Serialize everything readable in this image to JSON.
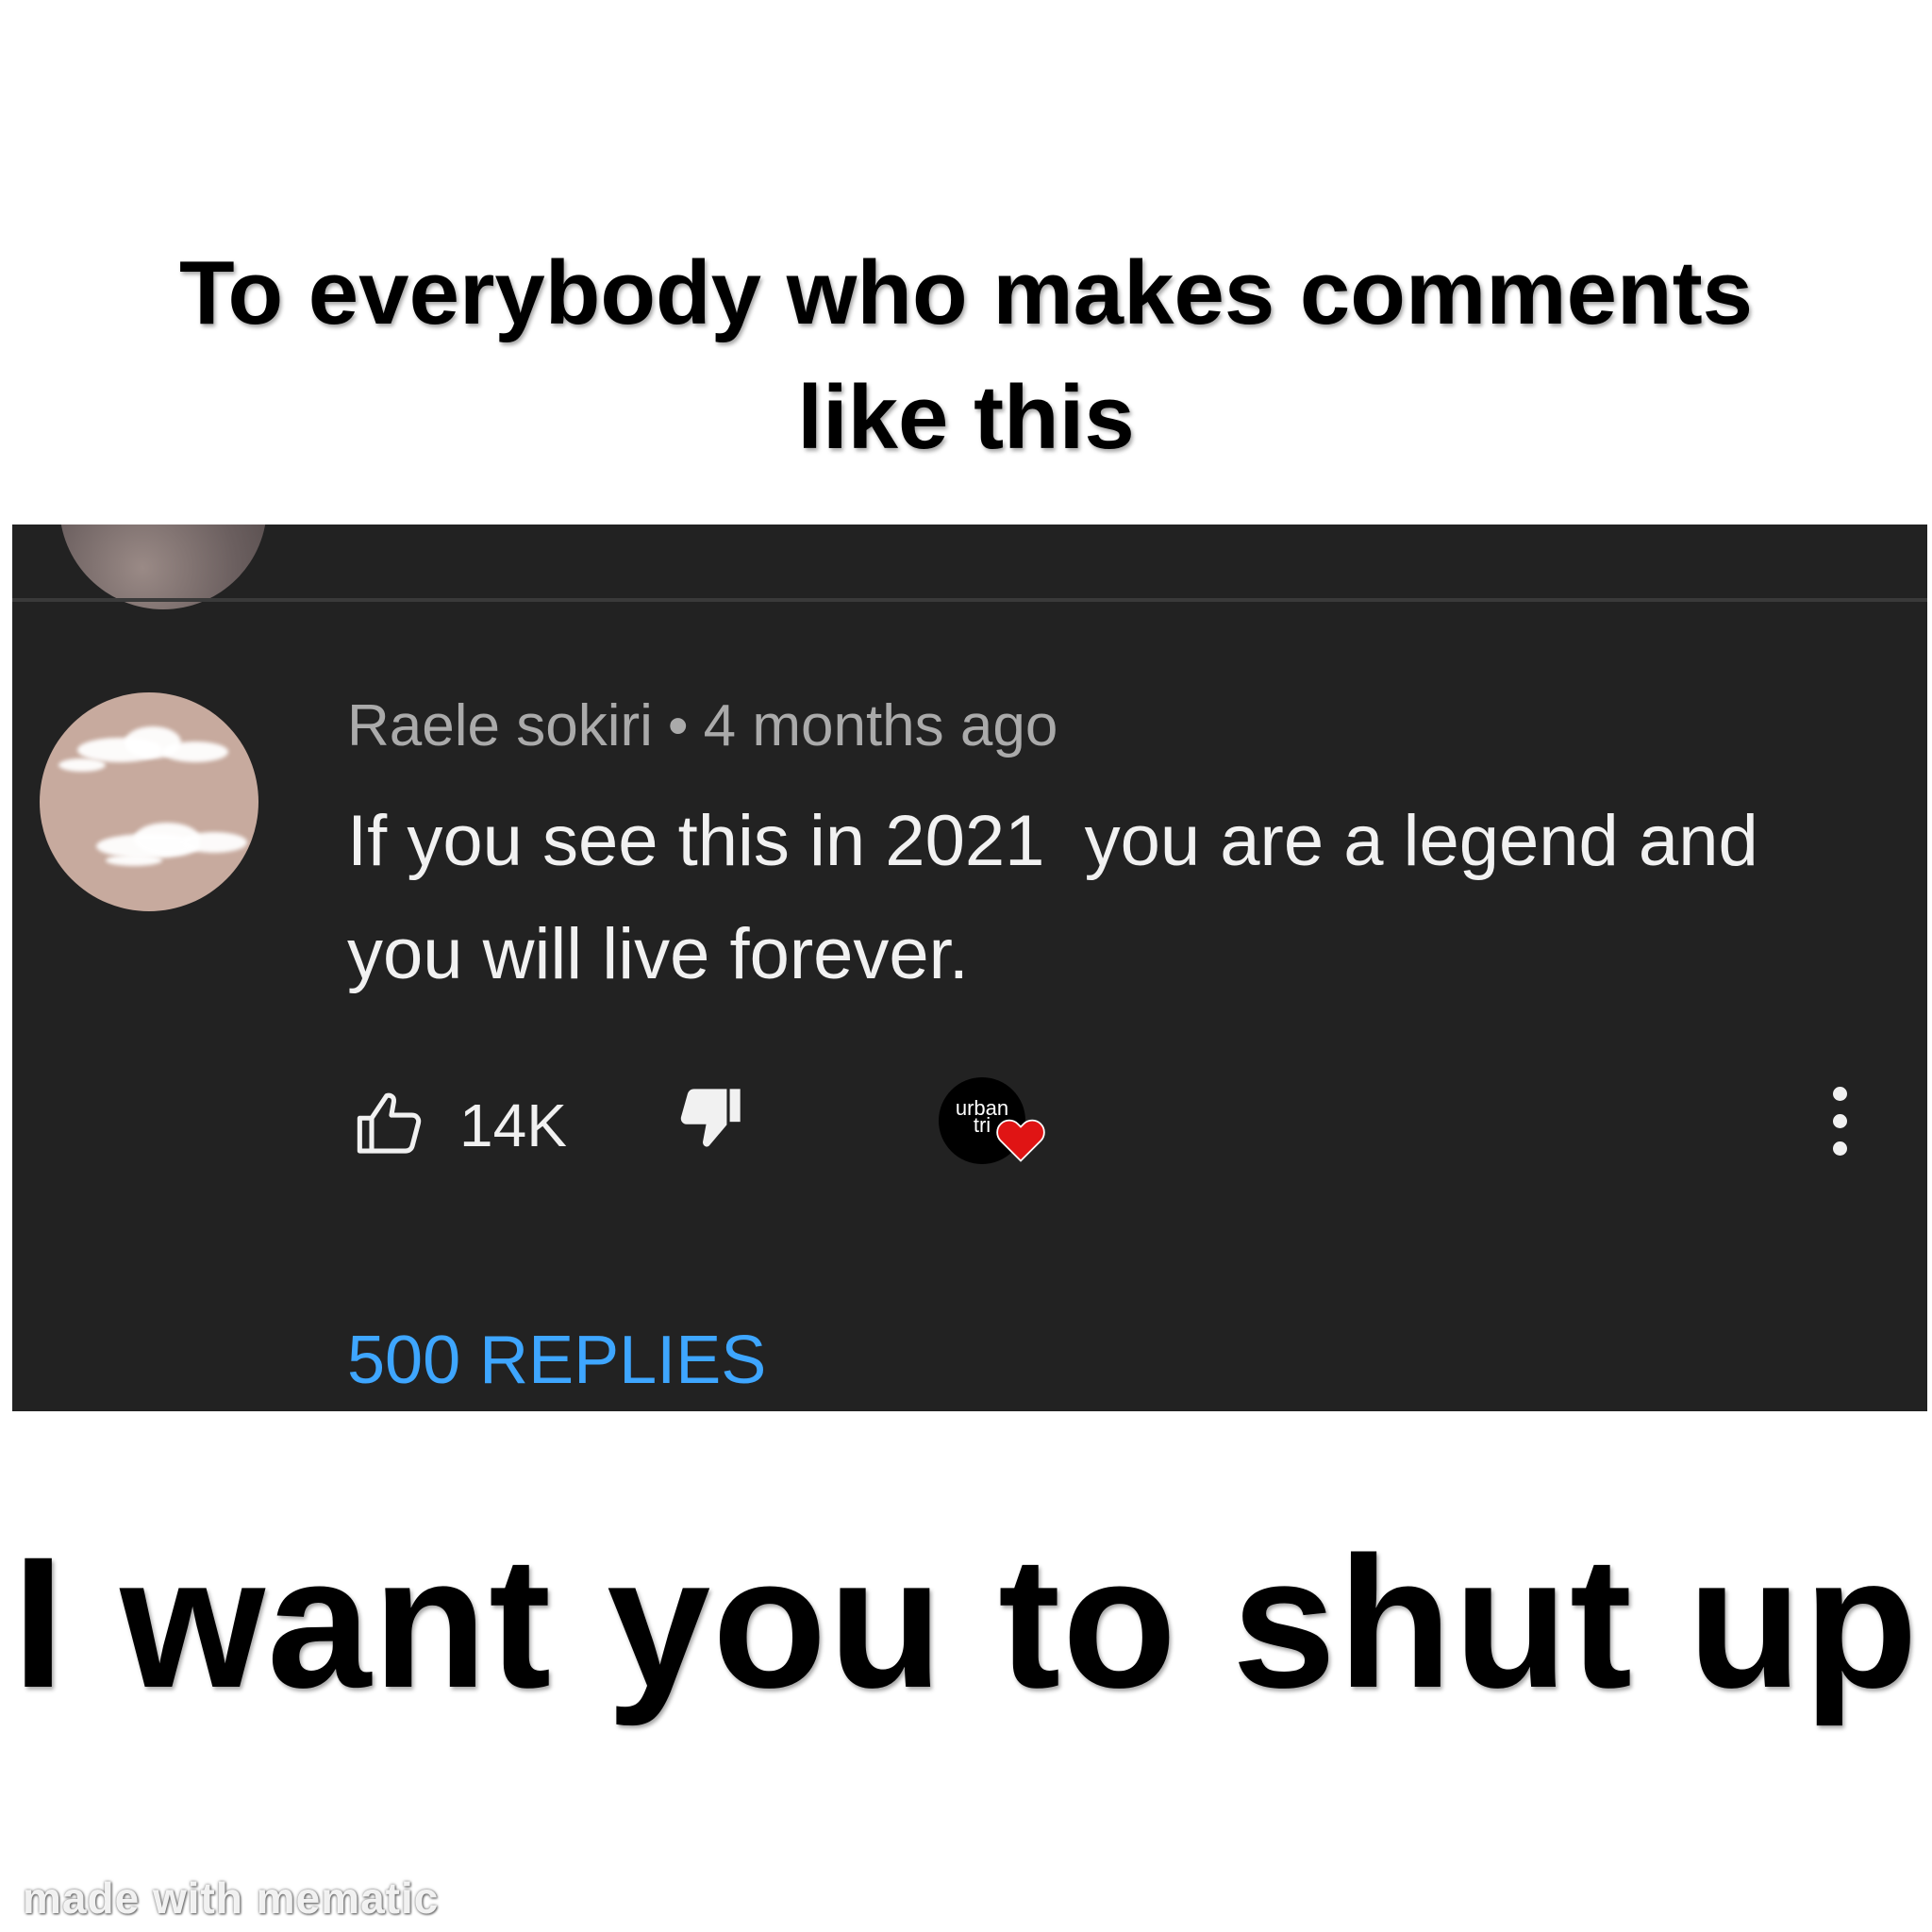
{
  "meme": {
    "top_caption": [
      "To everybody who makes comments",
      "like this"
    ],
    "bottom_caption": "I want you to shut up",
    "watermark": "made with mematic"
  },
  "comment": {
    "author": "Raele sokiri",
    "separator": "•",
    "timestamp": "4 months ago",
    "text": "If you see this in 2021  you are a legend and\nyou will live forever.",
    "like_count": "14K",
    "creator_avatar_text": "urban\ntri",
    "replies_label": "500 REPLIES"
  },
  "icons": {
    "like": "thumbs-up-icon",
    "dislike": "thumbs-down-icon",
    "heart": "heart-icon",
    "more": "more-vertical-icon"
  },
  "colors": {
    "panel_background": "#222222",
    "text_primary": "#f1f1f1",
    "text_secondary": "#aaaaaa",
    "replies_link": "#3ea6ff",
    "heart": "#e01414"
  }
}
